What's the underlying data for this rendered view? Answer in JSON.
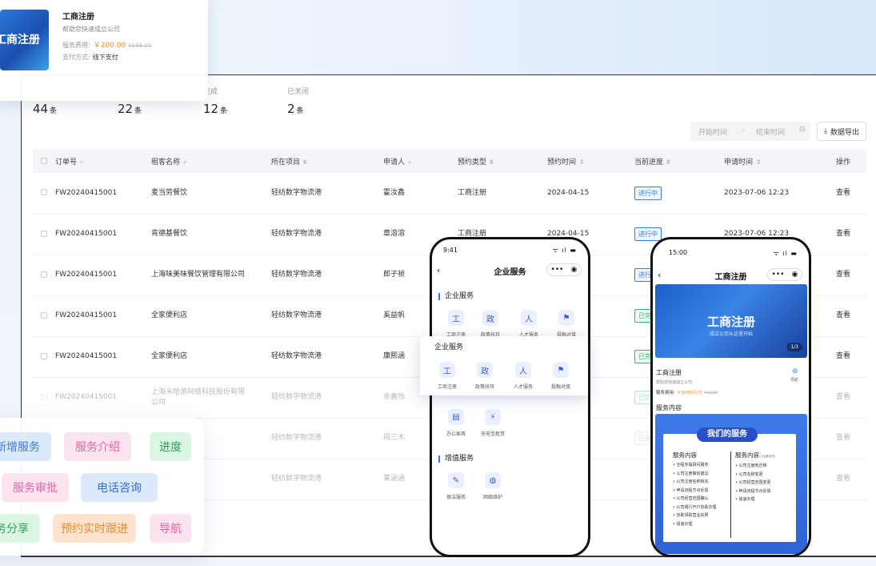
{
  "service_card": {
    "thumb_text": "工商注册",
    "title": "工商注册",
    "subtitle": "帮助您快速成立公司",
    "fee_label": "服务费用:",
    "fee_price": "￥200.00",
    "fee_original": "¥599.00",
    "pay_label": "支付方式:",
    "pay_value": "线下支付"
  },
  "stats": [
    {
      "label": "",
      "value": "44",
      "unit": "条"
    },
    {
      "label": "",
      "value": "22",
      "unit": "条"
    },
    {
      "label": "完成",
      "value": "12",
      "unit": "条"
    },
    {
      "label": "已关闭",
      "value": "2",
      "unit": "条"
    }
  ],
  "filters": {
    "start_placeholder": "开始时间",
    "sep": "–",
    "end_placeholder": "结束时间",
    "export_label": "数据导出"
  },
  "table": {
    "columns": [
      "订单号",
      "租客名称",
      "所在项目",
      "申请人",
      "预约类型",
      "预约时间",
      "当前进度",
      "申请时间",
      "操作"
    ],
    "rows": [
      {
        "order": "FW20240415001",
        "tenant": "麦当劳餐饮",
        "project": "轻纺数字物流港",
        "applicant": "霍汝鑫",
        "type": "工商注册",
        "appt": "2024-04-15",
        "status": "进行中",
        "status_kind": "progress",
        "applied": "2023-07-06 12:23",
        "action": "查看"
      },
      {
        "order": "FW20240415001",
        "tenant": "肯德基餐饮",
        "project": "轻纺数字物流港",
        "applicant": "章溶溶",
        "type": "工商注册",
        "appt": "2024-04-15",
        "status": "进行中",
        "status_kind": "progress",
        "applied": "2023-07-06 12:23",
        "action": "查看"
      },
      {
        "order": "FW20240415001",
        "tenant": "上海味美味餐饮管理有限公司",
        "project": "轻纺数字物流港",
        "applicant": "郎子祯",
        "type": "",
        "appt": "",
        "status": "进行",
        "status_kind": "progress",
        "applied": "",
        "action": "查看"
      },
      {
        "order": "FW20240415001",
        "tenant": "全家便利店",
        "project": "轻纺数字物流港",
        "applicant": "奚益帆",
        "type": "",
        "appt": "",
        "status": "已完",
        "status_kind": "done",
        "applied": "",
        "action": "查看"
      },
      {
        "order": "FW20240415001",
        "tenant": "全家便利店",
        "project": "轻纺数字物流港",
        "applicant": "康熙涵",
        "type": "",
        "appt": "",
        "status": "已完",
        "status_kind": "done",
        "applied": "",
        "action": "查看"
      },
      {
        "order": "FW20240415001",
        "tenant": "上海米哈游网络科技股份有限公司",
        "project": "轻纺数字物流港",
        "applicant": "余嘉怡",
        "type": "",
        "appt": "",
        "status": "已完",
        "status_kind": "done",
        "applied": "",
        "action": "查看"
      },
      {
        "order": "",
        "tenant": "科技股",
        "project": "轻纺数字物流港",
        "applicant": "周三木",
        "type": "",
        "appt": "",
        "status": "已关",
        "status_kind": "closed",
        "applied": "",
        "action": "查看"
      },
      {
        "order": "",
        "tenant": "科技股",
        "project": "轻纺数字物流港",
        "applicant": "某涵涵",
        "type": "",
        "appt": "",
        "status": "",
        "status_kind": "closed",
        "applied": "",
        "action": "查看"
      }
    ]
  },
  "tags": [
    {
      "label": "新增服务",
      "bg": "#dbe9fb",
      "fg": "#3a7be0"
    },
    {
      "label": "服务介绍",
      "bg": "#fbe3f0",
      "fg": "#e466a3"
    },
    {
      "label": "进度",
      "bg": "#dcf6e4",
      "fg": "#2e9e57"
    },
    {
      "label": "服务审批",
      "bg": "#fbe3f0",
      "fg": "#e466a3"
    },
    {
      "label": "电话咨询",
      "bg": "#dbe9fb",
      "fg": "#2f6fde"
    },
    {
      "label": "务分享",
      "bg": "#dcf6e4",
      "fg": "#2e9e57"
    },
    {
      "label": "预约实时跟进",
      "bg": "#fde3cf",
      "fg": "#f08a24"
    },
    {
      "label": "导航",
      "bg": "#fbe3f0",
      "fg": "#e466a3"
    }
  ],
  "phone1": {
    "time": "9:41",
    "signal": "ᯤ ıl ▬",
    "title": "企业服务",
    "section1": "企业服务",
    "section1_items": [
      "工商注册",
      "政策扶持",
      "人才服务",
      "投融对接"
    ],
    "popup_title": "企业服务",
    "popup_items": [
      "工商注册",
      "政策扶持",
      "人才服务",
      "投融对接"
    ],
    "row2_items": [
      "办公家具",
      "充电宝租赁"
    ],
    "section2": "增值服务",
    "section2_items": [
      "保洁服务",
      "网络维护"
    ]
  },
  "phone2": {
    "time": "15:00",
    "signal": "ᯤ ıl ▬",
    "title": "工商注册",
    "banner_title": "工商注册",
    "banner_sub": "成立公司从这里开始",
    "banner_page": "1/3",
    "name": "工商注册",
    "sub": "帮助您快速成立公司",
    "fee_label": "服务费用:",
    "fee_price": "￥3000元/次",
    "fee_original": "¥1299",
    "nav_label": "导航",
    "content_title": "服务内容",
    "poster_head": "我们的服务",
    "col1_title": "服务内容",
    "col1": [
      "• 全程专属顾问服务",
      "• 公司注册策划建议",
      "• 公司注册名称核名",
      "• 申请流程节点反馈",
      "• 公司经营范围确认",
      "• 公司银行开户协助办理",
      "• 协助领取营业执照",
      "• 极速办理"
    ],
    "col2_title": "服务内容",
    "col2_note": "(已含要求项)",
    "col2": [
      "• 公司注册地迁移",
      "• 公司名称变更",
      "• 公司经营范围变更",
      "• 申请流程节点反馈",
      "• 极速办理"
    ]
  },
  "colors": {
    "accent": "#3a7be0",
    "success": "#3cb371",
    "warning": "#f08a24"
  }
}
